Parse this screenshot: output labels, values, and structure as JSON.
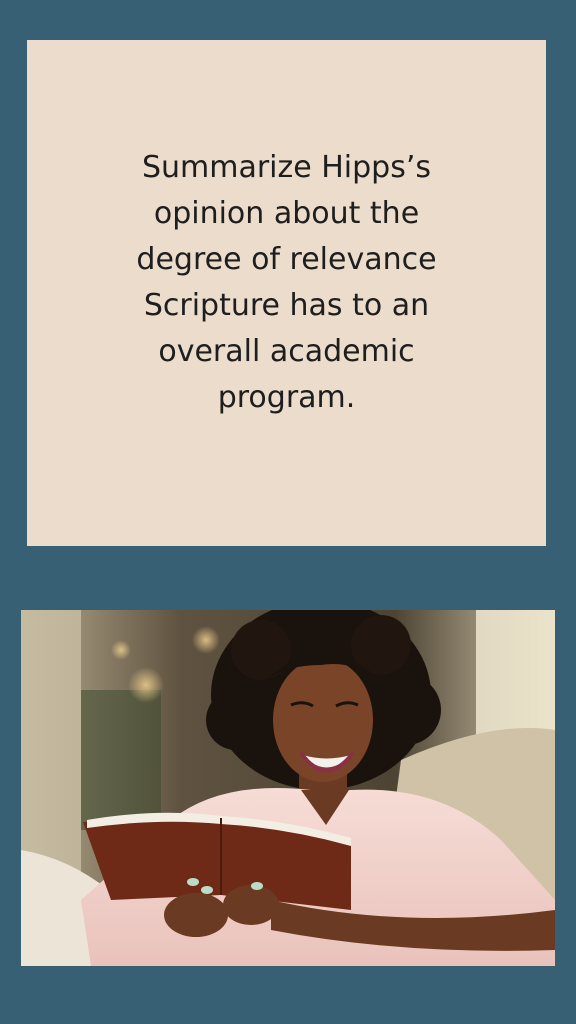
{
  "question": {
    "lines": [
      "Summarize Hipps’s",
      "opinion about the",
      "degree of relevance",
      "Scripture has to an",
      "overall academic",
      "program."
    ]
  },
  "colors": {
    "background": "#386074",
    "card": "#ecdccb",
    "text": "#1e1e1e"
  },
  "photo": {
    "subject": "woman-reading-book-smiling"
  }
}
